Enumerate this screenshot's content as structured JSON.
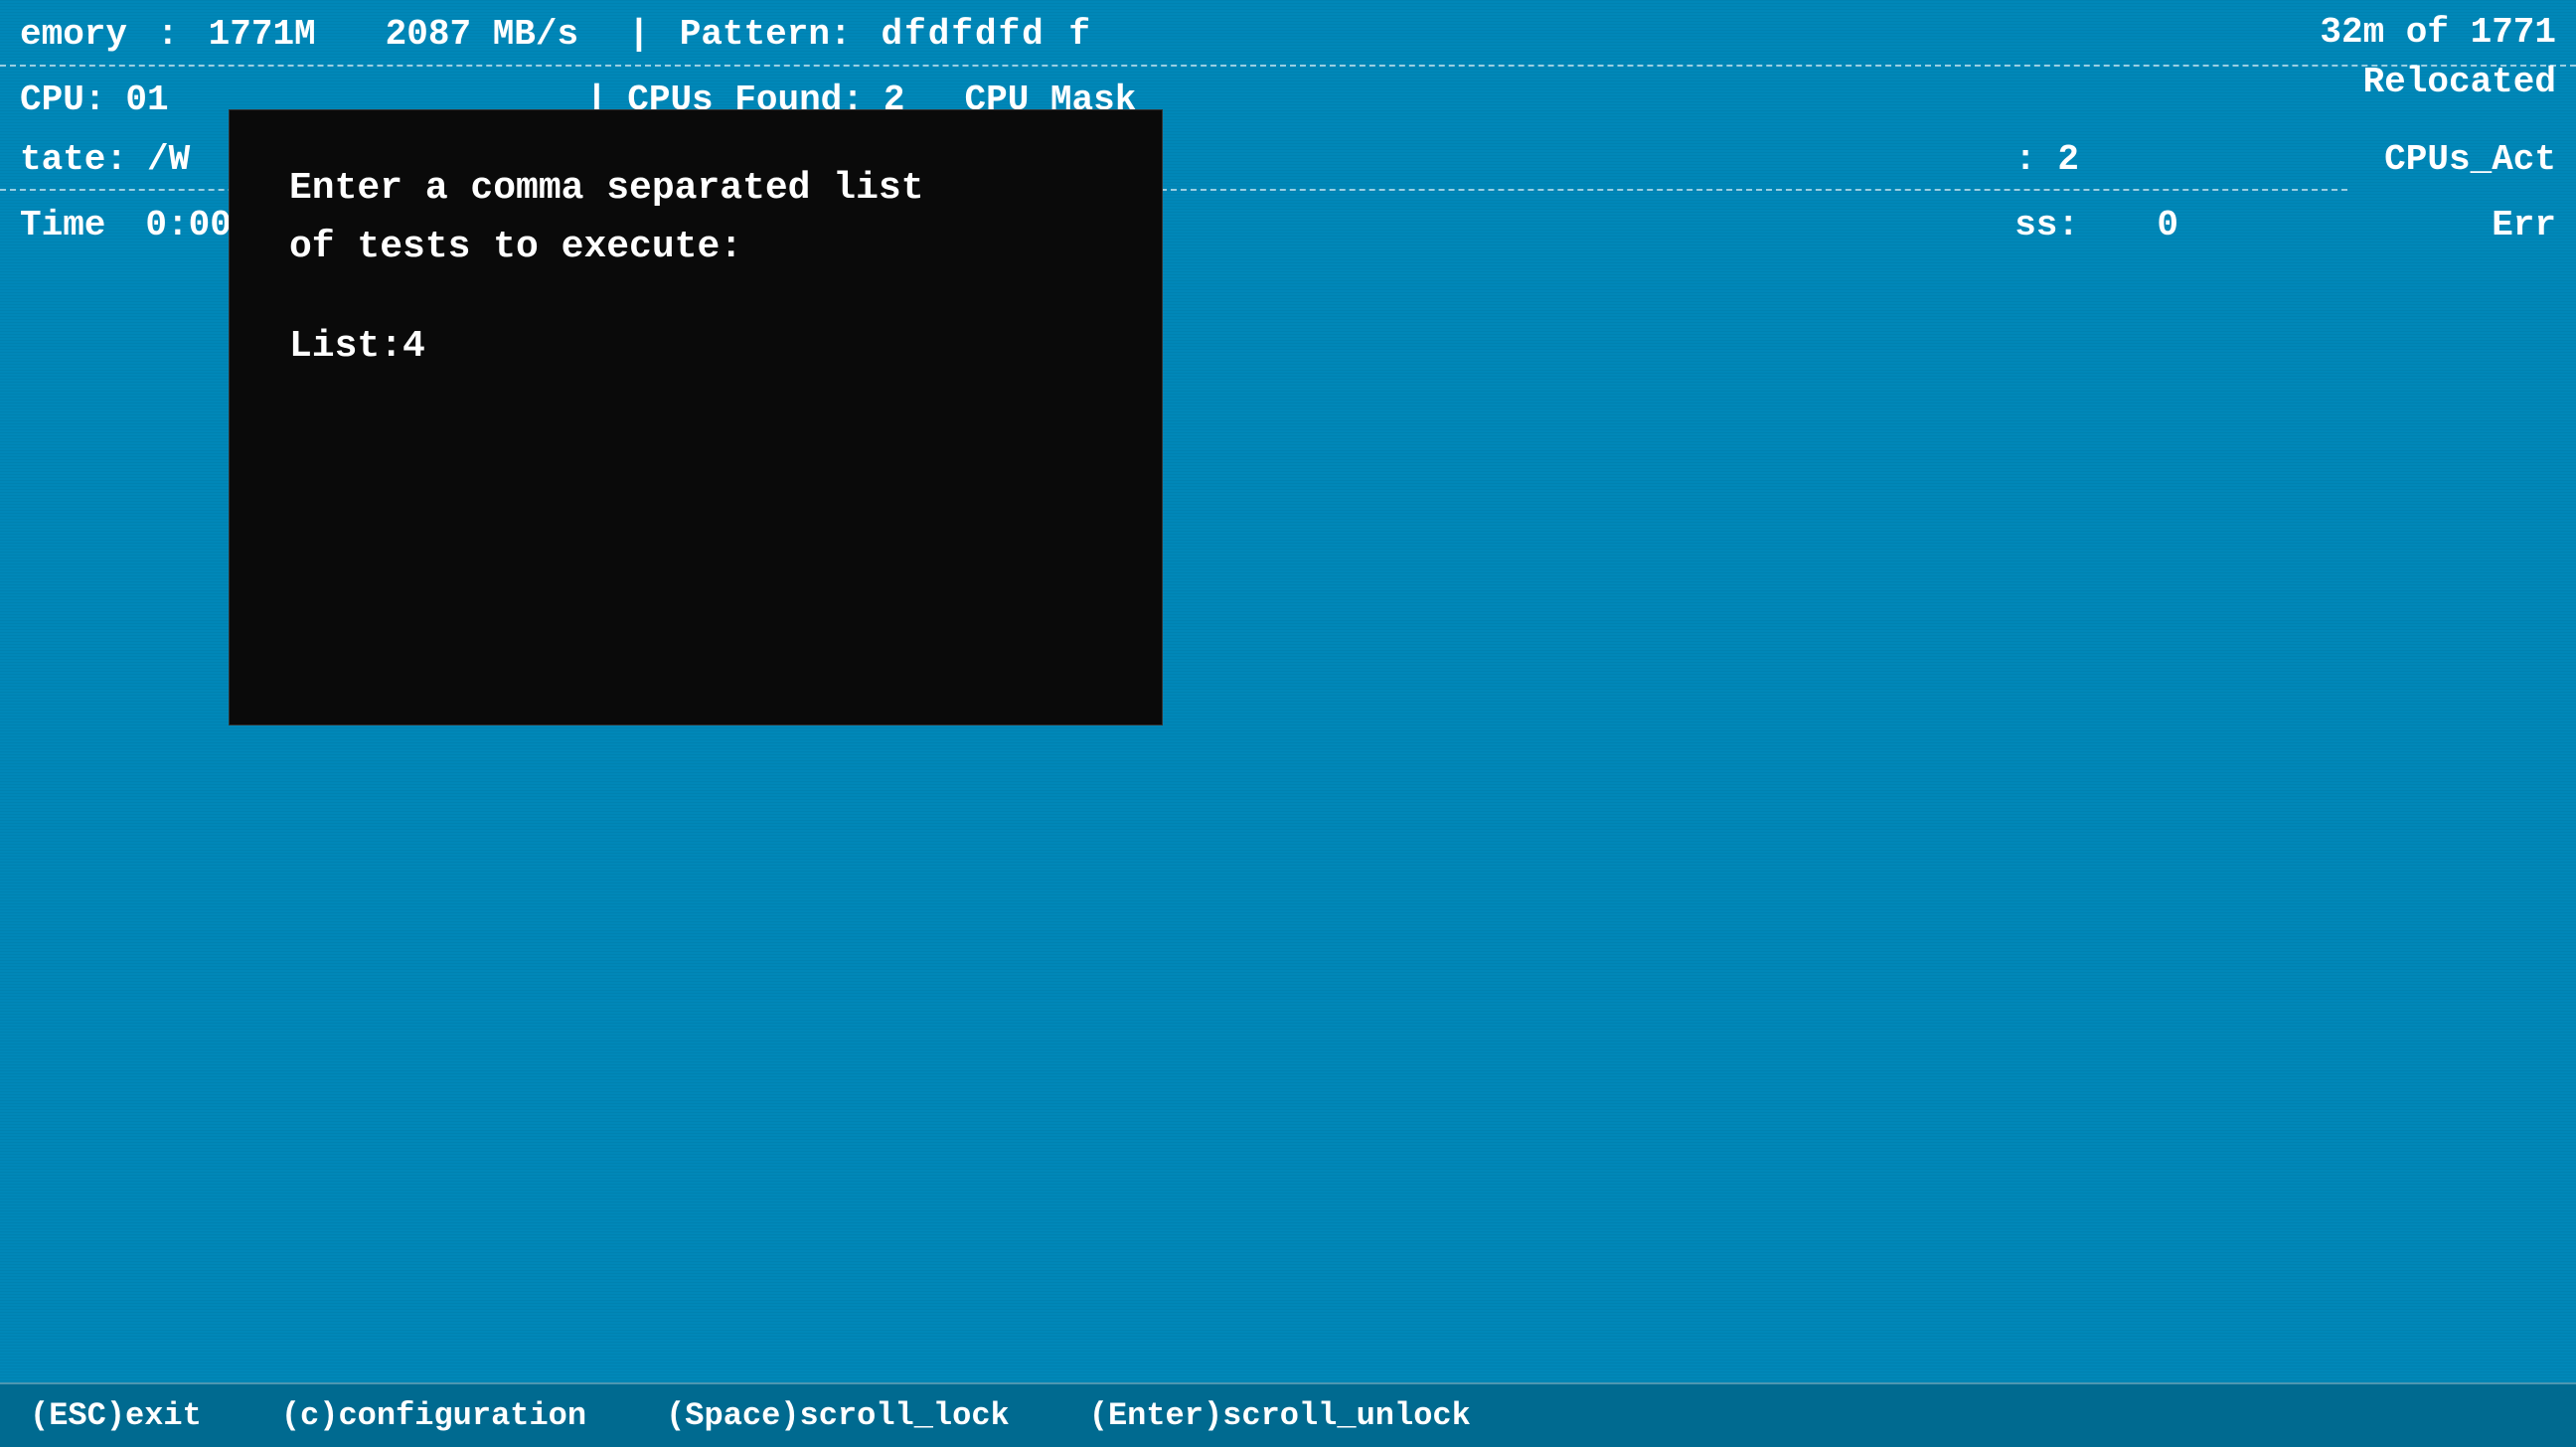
{
  "header": {
    "memory_label": "emory",
    "memory_colon": ":",
    "memory_value": "1771M",
    "bandwidth_value": "2087 MB/s",
    "pipe1": "|",
    "pattern_label": "Pattern:",
    "pattern_value": "dfdfdfd f",
    "right_top1": "32m of 1771",
    "right_top2": "Relocated",
    "cpu_label": "CPU:",
    "cpu_value": "01",
    "cpus_found_label": "CPUs_Found:",
    "cpus_found_value": "2",
    "cpu_mask_label": "CPU_Mask",
    "state_label": "tate:",
    "state_value": "/W",
    "colon2": ":",
    "value2": "2",
    "cpus_act_label": "CPUs_Act"
  },
  "time_row": {
    "time_label": "Time",
    "time_value": "0:00",
    "pass_ss_label": "ss:",
    "pass_ss_value": "0",
    "err_label": "Err"
  },
  "modal": {
    "line1": "Enter a comma separated list",
    "line2": "of tests to execute:",
    "input_label": "List:",
    "input_value": "4"
  },
  "bottom_bar": {
    "esc_item": "(ESC)exit",
    "config_item": "(c)configuration",
    "space_item": "(Space)scroll_lock",
    "enter_item": "(Enter)scroll_unlock"
  }
}
